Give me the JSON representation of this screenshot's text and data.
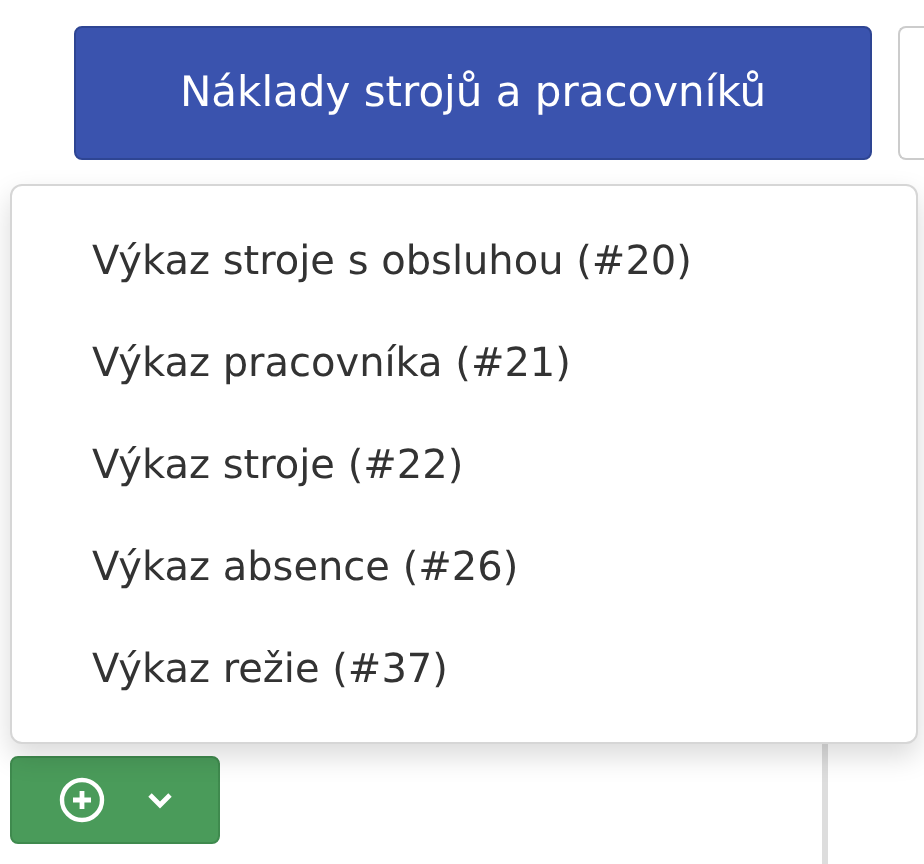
{
  "primary_button": {
    "label": "Náklady strojů a pracovníků"
  },
  "menu": {
    "items": [
      {
        "label": "Výkaz stroje s obsluhou (#20)"
      },
      {
        "label": "Výkaz pracovníka (#21)"
      },
      {
        "label": "Výkaz stroje (#22)"
      },
      {
        "label": "Výkaz absence (#26)"
      },
      {
        "label": "Výkaz režie (#37)"
      }
    ]
  }
}
